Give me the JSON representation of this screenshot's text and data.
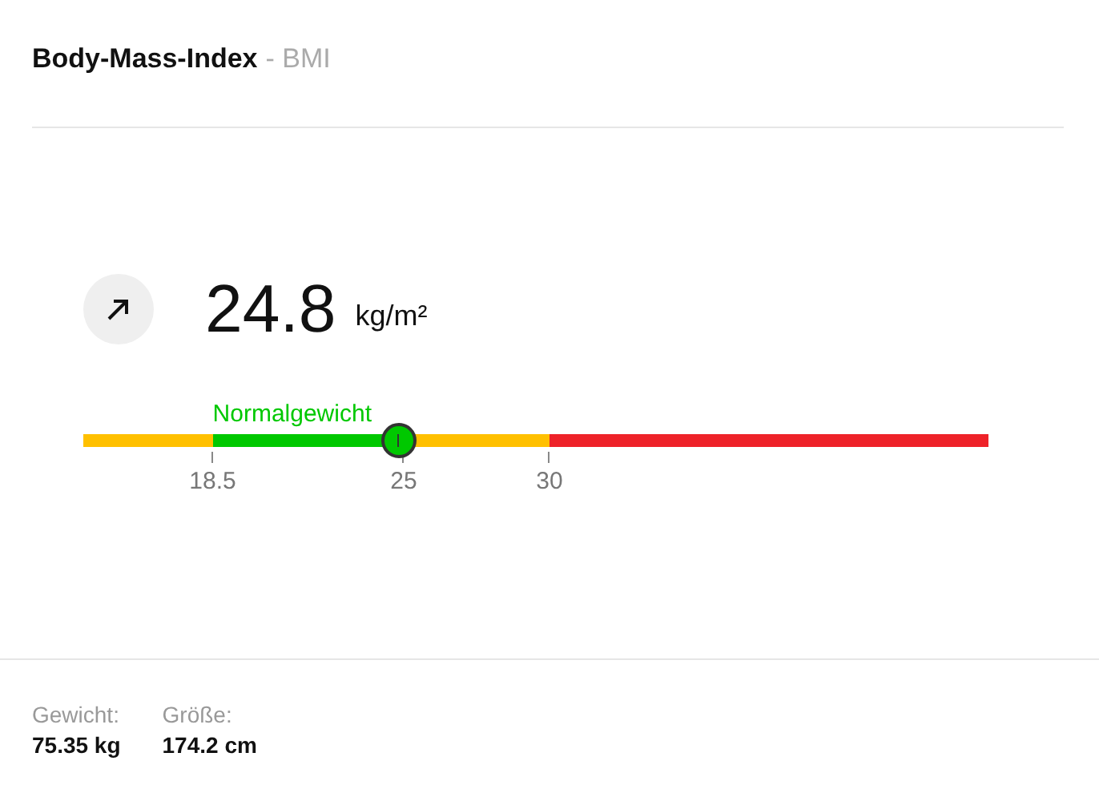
{
  "header": {
    "title": "Body-Mass-Index",
    "subtitle": "- BMI"
  },
  "reading": {
    "value": "24.8",
    "unit": "kg/m²"
  },
  "scale": {
    "marker": {
      "level": 0.348
    },
    "segments": [
      {
        "color": "#ffc000",
        "end_label": "18.5"
      },
      {
        "color": "#00c800",
        "end_label": "25",
        "label": "Normalgewicht"
      },
      {
        "color": "#ffc000",
        "end_label": "30"
      },
      {
        "color": "#ee2229"
      }
    ]
  },
  "details": [
    {
      "label": "Gewicht:",
      "value": "75.35 kg"
    },
    {
      "label": "Größe:",
      "value": "174.2 cm"
    }
  ]
}
